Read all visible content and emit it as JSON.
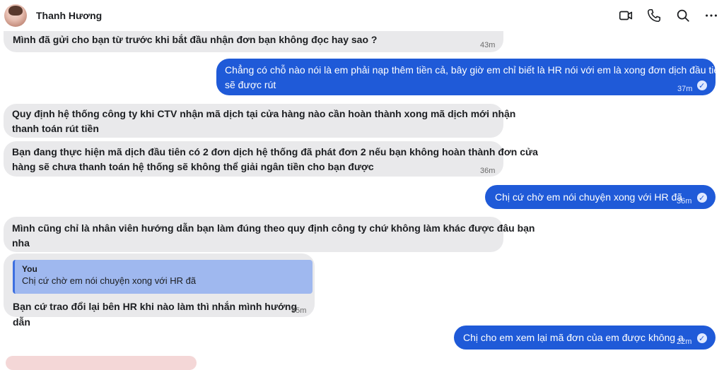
{
  "contact": {
    "name": "Thanh Hương"
  },
  "header_icons": [
    "video-call-icon",
    "phone-icon",
    "search-icon",
    "more-icon"
  ],
  "messages": [
    {
      "text": "Mình đã gửi cho bạn từ trước khi bắt đầu nhận đơn bạn không đọc hay sao ?",
      "time": "43m"
    },
    {
      "text_line1": "Chẳng có chỗ nào nói là em phải nạp thêm tiền cả, bây giờ em chỉ biết là HR nói với em là xong đơn dịch đầu tiên",
      "text_line2": "sẽ được rút",
      "time": "37m"
    },
    {
      "text_line1": "Quy định hệ thống công ty khi CTV nhận mã dịch tại cửa hàng nào cần hoàn thành xong mã dịch mới nhận",
      "text_line2": "thanh toán rút tiền"
    },
    {
      "text_line1": "Bạn đang thực hiện mã dịch đầu tiên có 2 đơn dịch hệ thống đã phát đơn 2 nếu bạn không hoàn thành đơn cửa",
      "text_line2": "hàng sẽ chưa thanh toán hệ thống sẽ không thể giải ngân tiền cho bạn được",
      "time": "36m"
    },
    {
      "text": "Chị cứ chờ em nói chuyện xong với HR đã",
      "time": "36m"
    },
    {
      "text_line1": "Mình cũng chỉ là nhân viên hướng dẫn bạn làm đúng theo quy định công ty chứ không làm khác được đâu bạn",
      "text_line2": "nha"
    },
    {
      "reply_author": "You",
      "reply_text": "Chị cứ chờ em nói chuyện xong với HR đã",
      "text": "Bạn cứ trao đổi lại bên HR khi nào làm thì nhắn mình hướng dẫn",
      "time": "35m"
    },
    {
      "text": "Chị cho em xem lại mã đơn của em được không ạ",
      "time": "22m"
    }
  ]
}
